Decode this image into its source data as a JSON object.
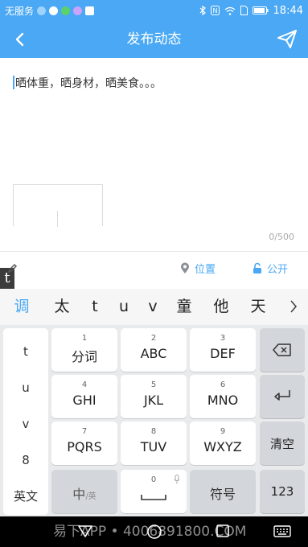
{
  "status_bar": {
    "carrier": "无服务",
    "time": "18:44",
    "left_icons": [
      "cloud-icon",
      "q-icon",
      "app-icon",
      "app2-icon",
      "gallery-icon"
    ],
    "right_icons": [
      "bluetooth-icon",
      "nfc-icon",
      "wifi-icon",
      "sim-icon",
      "battery-icon"
    ]
  },
  "header": {
    "title": "发布动态",
    "back_icon": "back-arrow-icon",
    "send_icon": "send-icon",
    "bg_color": "#4aa8f4"
  },
  "editor": {
    "text": "晒体重，晒身材，晒美食。。。",
    "char_count": "0/500"
  },
  "options": {
    "location_label": "位置",
    "public_label": "公开",
    "t_badge": "t",
    "accent_color": "#4aa8f4"
  },
  "candidates": [
    "调",
    "太",
    "t",
    "u",
    "v",
    "童",
    "他",
    "天"
  ],
  "keyboard": {
    "left_column": [
      "t",
      "u",
      "v",
      "8",
      "英文"
    ],
    "keys": [
      {
        "num": "1",
        "label": "分词"
      },
      {
        "num": "2",
        "label": "ABC"
      },
      {
        "num": "3",
        "label": "DEF"
      },
      {
        "num": "4",
        "label": "GHI"
      },
      {
        "num": "5",
        "label": "JKL"
      },
      {
        "num": "6",
        "label": "MNO"
      },
      {
        "num": "7",
        "label": "PQRS"
      },
      {
        "num": "8",
        "label": "TUV"
      },
      {
        "num": "9",
        "label": "WXYZ"
      }
    ],
    "side_keys": {
      "clear": "清空",
      "numbers": "123"
    },
    "bottom": {
      "lang_main": "中",
      "lang_sub": "/英",
      "space_num": "0",
      "symbols": "符号"
    }
  },
  "watermark": "易下APP • 4006891800.COM"
}
